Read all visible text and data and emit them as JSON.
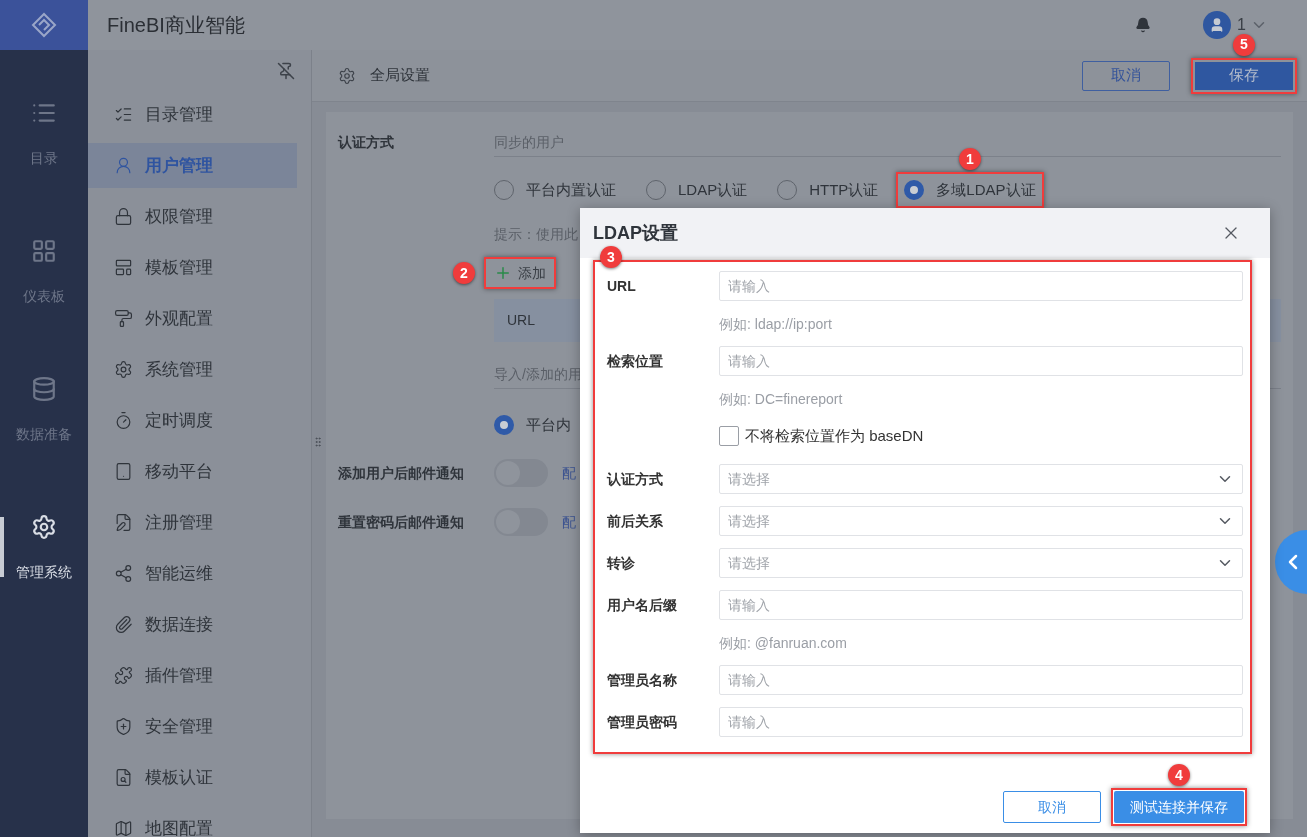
{
  "nav": {
    "items": [
      {
        "label": "目录",
        "selected": false
      },
      {
        "label": "仪表板",
        "selected": false
      },
      {
        "label": "数据准备",
        "selected": false
      },
      {
        "label": "管理系统",
        "selected": true
      }
    ]
  },
  "header": {
    "title": "FineBI商业智能",
    "user": "1"
  },
  "sidebar": {
    "items": [
      {
        "label": "目录管理",
        "selected": false
      },
      {
        "label": "用户管理",
        "selected": true
      },
      {
        "label": "权限管理",
        "selected": false
      },
      {
        "label": "模板管理",
        "selected": false
      },
      {
        "label": "外观配置",
        "selected": false
      },
      {
        "label": "系统管理",
        "selected": false
      },
      {
        "label": "定时调度",
        "selected": false
      },
      {
        "label": "移动平台",
        "selected": false
      },
      {
        "label": "注册管理",
        "selected": false
      },
      {
        "label": "智能运维",
        "selected": false
      },
      {
        "label": "数据连接",
        "selected": false
      },
      {
        "label": "插件管理",
        "selected": false
      },
      {
        "label": "安全管理",
        "selected": false
      },
      {
        "label": "模板认证",
        "selected": false
      },
      {
        "label": "地图配置",
        "selected": false
      }
    ]
  },
  "page": {
    "title": "全局设置",
    "buttons": [
      {
        "label": "取消",
        "kind": "secondary"
      },
      {
        "label": "保存",
        "kind": "primary",
        "callout": "5"
      }
    ],
    "auth": {
      "label": "认证方式",
      "sync_heading": "同步的用户",
      "options": [
        {
          "label": "平台内置认证",
          "selected": false
        },
        {
          "label": "LDAP认证",
          "selected": false
        },
        {
          "label": "HTTP认证",
          "selected": false
        },
        {
          "label": "多域LDAP认证",
          "selected": true,
          "callout": "1"
        }
      ],
      "hint": "提示：使用此",
      "add_button": {
        "label": "添加",
        "callout": "2"
      },
      "table_columns": [
        "URL"
      ],
      "import_heading": "导入/添加的用",
      "import_options": [
        {
          "label": "平台内",
          "selected": true
        }
      ]
    },
    "notifications": [
      {
        "label": "添加用户后邮件通知",
        "on": false,
        "link": "配"
      },
      {
        "label": "重置密码后邮件通知",
        "on": false,
        "link": "配"
      }
    ]
  },
  "dialog": {
    "title": "LDAP设置",
    "callout": "3",
    "fields": [
      {
        "kind": "input",
        "label": "URL",
        "placeholder": "请输入",
        "hint": "例如: ldap://ip:port"
      },
      {
        "kind": "input",
        "label": "检索位置",
        "placeholder": "请输入",
        "hint": "例如: DC=finereport"
      },
      {
        "kind": "checkbox",
        "label": "不将检索位置作为 baseDN",
        "checked": false
      },
      {
        "kind": "select",
        "label": "认证方式",
        "placeholder": "请选择"
      },
      {
        "kind": "select",
        "label": "前后关系",
        "placeholder": "请选择"
      },
      {
        "kind": "select",
        "label": "转诊",
        "placeholder": "请选择"
      },
      {
        "kind": "input",
        "label": "用户名后缀",
        "placeholder": "请输入",
        "hint": "例如: @fanruan.com"
      },
      {
        "kind": "input",
        "label": "管理员名称",
        "placeholder": "请输入"
      },
      {
        "kind": "input",
        "label": "管理员密码",
        "placeholder": "请输入"
      }
    ],
    "buttons": [
      {
        "label": "取消",
        "kind": "secondary"
      },
      {
        "label": "测试连接并保存",
        "kind": "primary",
        "callout": "4"
      }
    ]
  }
}
